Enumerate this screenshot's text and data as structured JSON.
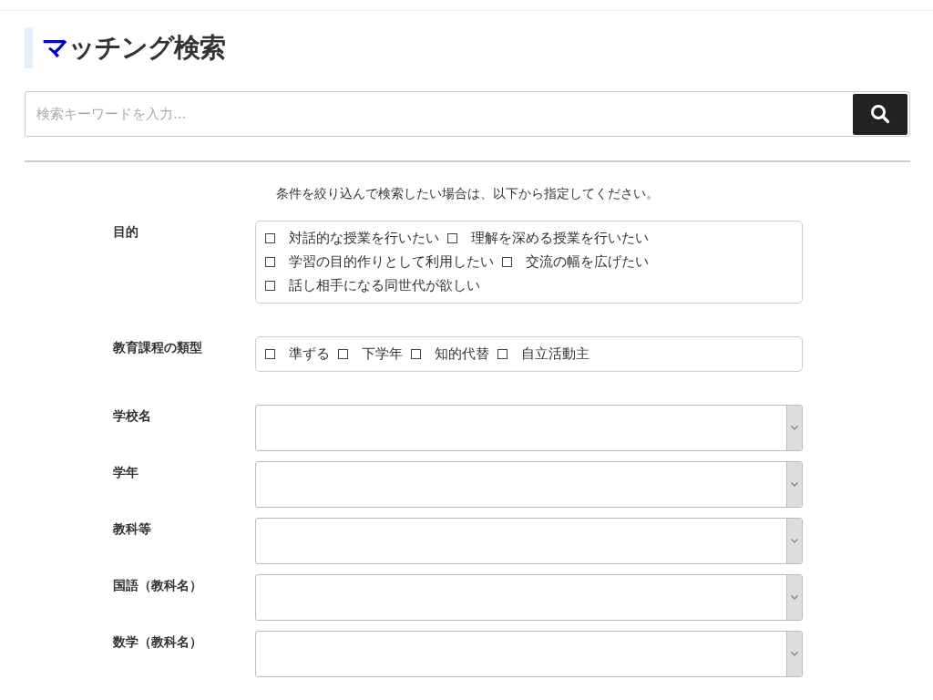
{
  "page_title": {
    "accent": "マ",
    "rest": "ッチング検索"
  },
  "search": {
    "placeholder": "検索キーワードを入力..."
  },
  "note": "条件を絞り込んで検索したい場合は、以下から指定してください。",
  "filters": [
    {
      "kind": "checkboxes",
      "label": "目的",
      "options": [
        {
          "label": "対話的な授業を行いたい",
          "checked": false
        },
        {
          "label": "理解を深める授業を行いたい",
          "checked": false
        },
        {
          "label": "学習の目的作りとして利用したい",
          "checked": false
        },
        {
          "label": "交流の幅を広げたい",
          "checked": false
        },
        {
          "label": "話し相手になる同世代が欲しい",
          "checked": false
        }
      ]
    },
    {
      "kind": "checkboxes",
      "label": "教育課程の類型",
      "options": [
        {
          "label": "準ずる",
          "checked": false
        },
        {
          "label": "下学年",
          "checked": false
        },
        {
          "label": "知的代替",
          "checked": false
        },
        {
          "label": "自立活動主",
          "checked": false
        }
      ]
    },
    {
      "kind": "select",
      "label": "学校名"
    },
    {
      "kind": "select",
      "label": "学年"
    },
    {
      "kind": "select",
      "label": "教科等"
    },
    {
      "kind": "select",
      "label": "国語（教科名）"
    },
    {
      "kind": "select",
      "label": "数学（教科名）"
    }
  ]
}
